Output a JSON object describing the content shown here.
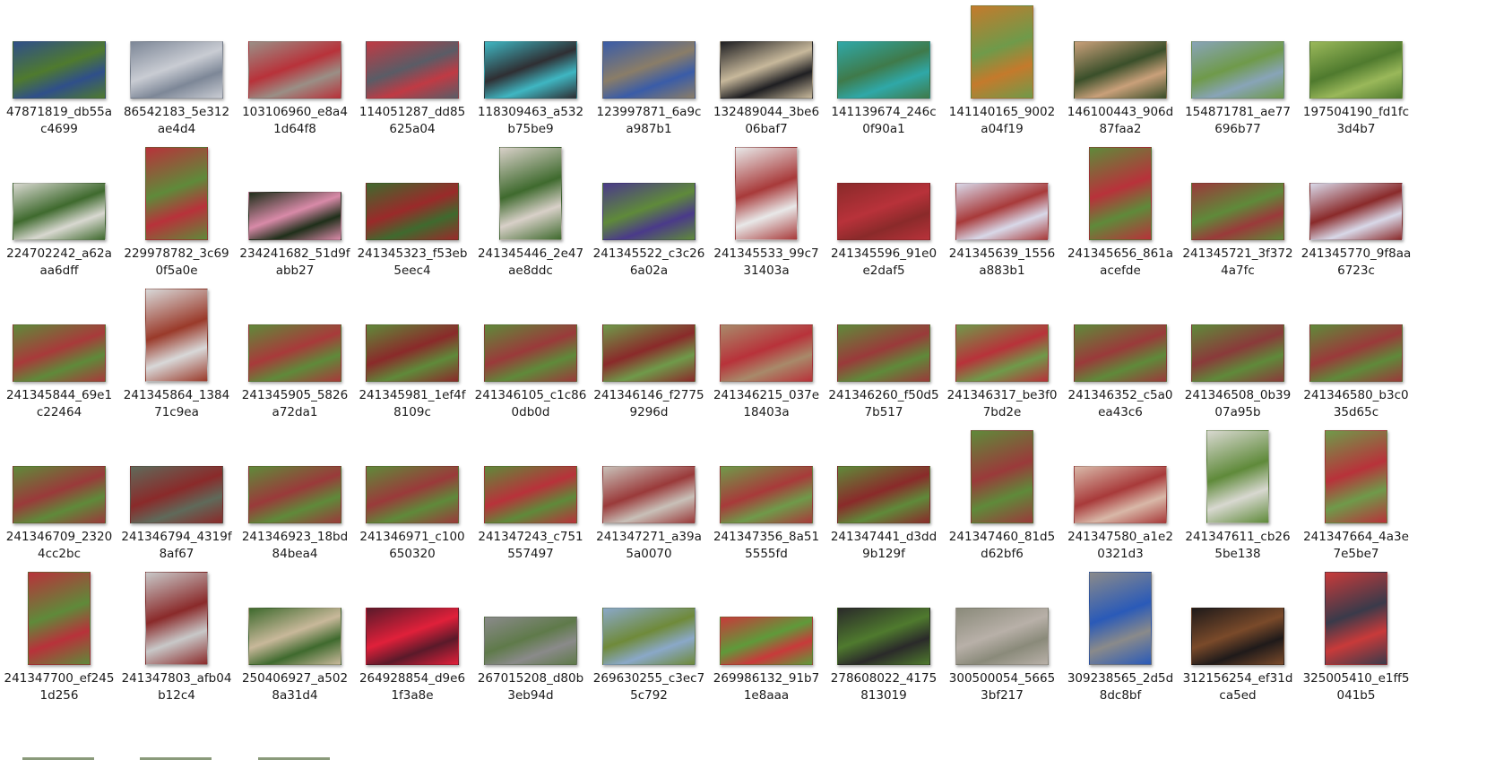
{
  "files": [
    {
      "l1": "47871819_db55a",
      "l2": "c4699",
      "thumb": "landscape",
      "colors": [
        "#4f7a2e",
        "#2f4f8a"
      ]
    },
    {
      "l1": "86542183_5e312",
      "l2": "ae4d4",
      "thumb": "landscape",
      "colors": [
        "#c9ccd3",
        "#7d8797"
      ]
    },
    {
      "l1": "103106960_e8a4",
      "l2": "1d64f8",
      "thumb": "landscape",
      "colors": [
        "#b8323a",
        "#9a8f86"
      ]
    },
    {
      "l1": "114051287_dd85",
      "l2": "625a04",
      "thumb": "landscape",
      "colors": [
        "#5a5c66",
        "#c03a44"
      ]
    },
    {
      "l1": "118309463_a532",
      "l2": "b75be9",
      "thumb": "landscape",
      "colors": [
        "#2f2f33",
        "#3fb6c2"
      ]
    },
    {
      "l1": "123997871_6a9c",
      "l2": "a987b1",
      "thumb": "landscape",
      "colors": [
        "#8a7d68",
        "#3a5ca8"
      ]
    },
    {
      "l1": "132489044_3be6",
      "l2": "06baf7",
      "thumb": "landscape",
      "colors": [
        "#c7b89b",
        "#1f1f22"
      ]
    },
    {
      "l1": "141139674_246c",
      "l2": "0f90a1",
      "thumb": "landscape",
      "colors": [
        "#3f7a4a",
        "#2fa8a8"
      ]
    },
    {
      "l1": "141140165_9002",
      "l2": "a04f19",
      "thumb": "portrait",
      "colors": [
        "#6f9a4a",
        "#c47a2c"
      ]
    },
    {
      "l1": "146100443_906d",
      "l2": "87faa2",
      "thumb": "landscape",
      "colors": [
        "#3a4f2a",
        "#c9a07a"
      ]
    },
    {
      "l1": "154871781_ae77",
      "l2": "696b77",
      "thumb": "landscape",
      "colors": [
        "#6f9a4a",
        "#88a4b8"
      ]
    },
    {
      "l1": "197504190_fd1fc",
      "l2": "3d4b7",
      "thumb": "landscape",
      "colors": [
        "#4f7a2e",
        "#9ab85a"
      ]
    },
    {
      "l1": "224702242_a62a",
      "l2": "aa6dff",
      "thumb": "landscape",
      "colors": [
        "#3f6a2e",
        "#d8d8d0"
      ]
    },
    {
      "l1": "229978782_3c69",
      "l2": "0f5a0e",
      "thumb": "portrait",
      "colors": [
        "#5f8a3a",
        "#b8323a"
      ]
    },
    {
      "l1": "234241682_51d9f",
      "l2": "abb27",
      "thumb": "landscape-short",
      "colors": [
        "#d88aa8",
        "#1f2f1a"
      ]
    },
    {
      "l1": "241345323_f53eb",
      "l2": "5eec4",
      "thumb": "landscape",
      "colors": [
        "#9a2a2a",
        "#3f6a2e"
      ]
    },
    {
      "l1": "241345446_2e47",
      "l2": "ae8ddc",
      "thumb": "portrait",
      "colors": [
        "#3f6a2e",
        "#d8d0c8"
      ]
    },
    {
      "l1": "241345522_c3c26",
      "l2": "6a02a",
      "thumb": "landscape",
      "colors": [
        "#5f8a3a",
        "#4a3a8a"
      ]
    },
    {
      "l1": "241345533_99c7",
      "l2": "31403a",
      "thumb": "portrait",
      "colors": [
        "#a83a3a",
        "#e8e8e8"
      ]
    },
    {
      "l1": "241345596_91e0",
      "l2": "e2daf5",
      "thumb": "landscape",
      "colors": [
        "#b8323a",
        "#8a2a2a"
      ]
    },
    {
      "l1": "241345639_1556",
      "l2": "a883b1",
      "thumb": "landscape",
      "colors": [
        "#a83a3a",
        "#d8d8e8"
      ]
    },
    {
      "l1": "241345656_861a",
      "l2": "acefde",
      "thumb": "portrait",
      "colors": [
        "#b8323a",
        "#5f8a3a"
      ]
    },
    {
      "l1": "241345721_3f372",
      "l2": "4a7fc",
      "thumb": "landscape",
      "colors": [
        "#5f8a3a",
        "#9a3a3a"
      ]
    },
    {
      "l1": "241345770_9f8aa",
      "l2": "6723c",
      "thumb": "landscape",
      "colors": [
        "#8a2a2a",
        "#d8d8e8"
      ]
    },
    {
      "l1": "241345844_69e1",
      "l2": "c22464",
      "thumb": "landscape",
      "colors": [
        "#a83a3a",
        "#5f8a3a"
      ]
    },
    {
      "l1": "241345864_1384",
      "l2": "71c9ea",
      "thumb": "portrait",
      "colors": [
        "#9a3a2a",
        "#d8d8d8"
      ]
    },
    {
      "l1": "241345905_5826",
      "l2": "a72da1",
      "thumb": "landscape",
      "colors": [
        "#a83a3a",
        "#5f8a3a"
      ]
    },
    {
      "l1": "241345981_1ef4f",
      "l2": "8109c",
      "thumb": "landscape",
      "colors": [
        "#8a2a2a",
        "#5f8a3a"
      ]
    },
    {
      "l1": "241346105_c1c86",
      "l2": "0db0d",
      "thumb": "landscape",
      "colors": [
        "#9a3a3a",
        "#5f8a3a"
      ]
    },
    {
      "l1": "241346146_f2775",
      "l2": "9296d",
      "thumb": "landscape",
      "colors": [
        "#8a2a2a",
        "#6f9a4a"
      ]
    },
    {
      "l1": "241346215_037e",
      "l2": "18403a",
      "thumb": "landscape",
      "colors": [
        "#b8323a",
        "#a88a6a"
      ]
    },
    {
      "l1": "241346260_f50d5",
      "l2": "7b517",
      "thumb": "landscape",
      "colors": [
        "#9a3a3a",
        "#5f8a3a"
      ]
    },
    {
      "l1": "241346317_be3f0",
      "l2": "7bd2e",
      "thumb": "landscape",
      "colors": [
        "#b8323a",
        "#6f9a4a"
      ]
    },
    {
      "l1": "241346352_c5a0",
      "l2": "ea43c6",
      "thumb": "landscape",
      "colors": [
        "#9a3a3a",
        "#5f8a3a"
      ]
    },
    {
      "l1": "241346508_0b39",
      "l2": "07a95b",
      "thumb": "landscape",
      "colors": [
        "#8a3a3a",
        "#5f8a3a"
      ]
    },
    {
      "l1": "241346580_b3c0",
      "l2": "35d65c",
      "thumb": "landscape",
      "colors": [
        "#9a3a3a",
        "#5f8a3a"
      ]
    },
    {
      "l1": "241346709_2320",
      "l2": "4cc2bc",
      "thumb": "landscape",
      "colors": [
        "#9a3a3a",
        "#5f8a3a"
      ]
    },
    {
      "l1": "241346794_4319f",
      "l2": "8af67",
      "thumb": "landscape",
      "colors": [
        "#8a2a2a",
        "#5f6a5a"
      ]
    },
    {
      "l1": "241346923_18bd",
      "l2": "84bea4",
      "thumb": "landscape",
      "colors": [
        "#9a3a3a",
        "#5f8a3a"
      ]
    },
    {
      "l1": "241346971_c100",
      "l2": "650320",
      "thumb": "landscape",
      "colors": [
        "#9a3a3a",
        "#5f8a3a"
      ]
    },
    {
      "l1": "241347243_c751",
      "l2": "557497",
      "thumb": "landscape",
      "colors": [
        "#b8323a",
        "#5f8a3a"
      ]
    },
    {
      "l1": "241347271_a39a",
      "l2": "5a0070",
      "thumb": "landscape",
      "colors": [
        "#9a3a3a",
        "#c8c0b8"
      ]
    },
    {
      "l1": "241347356_8a51",
      "l2": "5555fd",
      "thumb": "landscape",
      "colors": [
        "#a83a3a",
        "#6f9a4a"
      ]
    },
    {
      "l1": "241347441_d3dd",
      "l2": "9b129f",
      "thumb": "landscape",
      "colors": [
        "#8a2a2a",
        "#5f8a3a"
      ]
    },
    {
      "l1": "241347460_81d5",
      "l2": "d62bf6",
      "thumb": "portrait",
      "colors": [
        "#9a3a3a",
        "#5f8a3a"
      ]
    },
    {
      "l1": "241347580_a1e2",
      "l2": "0321d3",
      "thumb": "landscape",
      "colors": [
        "#a83a3a",
        "#d8b8a8"
      ]
    },
    {
      "l1": "241347611_cb26",
      "l2": "5be138",
      "thumb": "portrait",
      "colors": [
        "#5f8a3a",
        "#d8d8d0"
      ]
    },
    {
      "l1": "241347664_4a3e",
      "l2": "7e5be7",
      "thumb": "portrait",
      "colors": [
        "#b8323a",
        "#6f9a4a"
      ]
    },
    {
      "l1": "241347700_ef245",
      "l2": "1d256",
      "thumb": "portrait",
      "colors": [
        "#5f8a3a",
        "#b8323a"
      ]
    },
    {
      "l1": "241347803_afb04",
      "l2": "b12c4",
      "thumb": "portrait",
      "colors": [
        "#8a2a2a",
        "#c8c8c8"
      ]
    },
    {
      "l1": "250406927_a502",
      "l2": "8a31d4",
      "thumb": "landscape",
      "colors": [
        "#c8b89a",
        "#3f6a2e"
      ]
    },
    {
      "l1": "264928854_d9e6",
      "l2": "1f3a8e",
      "thumb": "landscape",
      "colors": [
        "#e0203a",
        "#5a1a2a"
      ]
    },
    {
      "l1": "267015208_d80b",
      "l2": "3eb94d",
      "thumb": "landscape-short",
      "colors": [
        "#5f7a4a",
        "#8a8a8a"
      ]
    },
    {
      "l1": "269630255_c3ec7",
      "l2": "5c792",
      "thumb": "landscape",
      "colors": [
        "#6f8a3a",
        "#8aa8c8"
      ]
    },
    {
      "l1": "269986132_91b7",
      "l2": "1e8aaa",
      "thumb": "landscape-short",
      "colors": [
        "#5f9a3a",
        "#c83a3a"
      ]
    },
    {
      "l1": "278608022_4175",
      "l2": "813019",
      "thumb": "landscape",
      "colors": [
        "#4f7a2e",
        "#2a2a2a"
      ]
    },
    {
      "l1": "300500054_5665",
      "l2": "3bf217",
      "thumb": "landscape",
      "colors": [
        "#b8b0a8",
        "#8a8a7a"
      ]
    },
    {
      "l1": "309238565_2d5d",
      "l2": "8dc8bf",
      "thumb": "portrait",
      "colors": [
        "#2a5ab8",
        "#8a8a8a"
      ]
    },
    {
      "l1": "312156254_ef31d",
      "l2": "ca5ed",
      "thumb": "landscape",
      "colors": [
        "#7a4a2a",
        "#1f1a1a"
      ]
    },
    {
      "l1": "325005410_e1ff5",
      "l2": "041b5",
      "thumb": "portrait",
      "colors": [
        "#3a3a4a",
        "#c83a3a"
      ]
    }
  ]
}
